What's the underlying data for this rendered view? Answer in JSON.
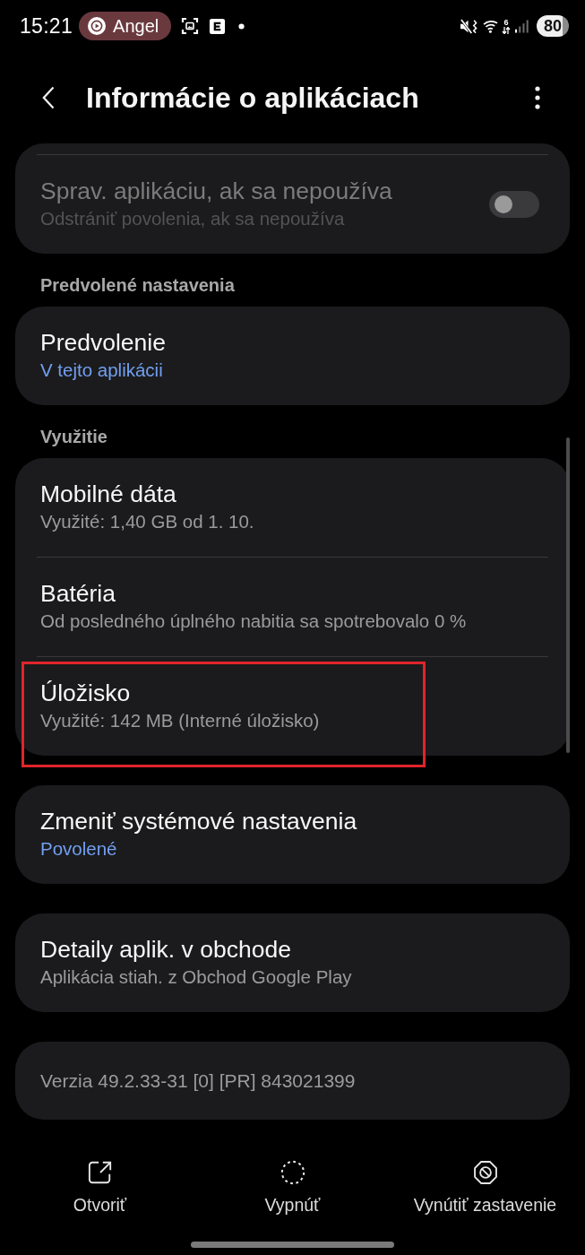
{
  "status_bar": {
    "time": "15:21",
    "chip_label": "Angel",
    "wifi_label": "6",
    "battery": "80"
  },
  "header": {
    "title": "Informácie o aplikáciach"
  },
  "sections": [
    {
      "cut_top": true,
      "items": [
        {
          "kind": "toggle",
          "title": "Sprav. aplikáciu, ak sa nepoužíva",
          "subtitle": "Odstrániť povolenia, ak sa nepoužíva",
          "on": false,
          "disabled": true,
          "highlighted": false
        }
      ]
    },
    {
      "heading": "Predvolené nastavenia",
      "cut_top": false,
      "items": [
        {
          "kind": "value",
          "title": "Predvolenie",
          "subtitle": "V tejto aplikácii",
          "disabled": false,
          "highlighted": false
        }
      ]
    },
    {
      "heading": "Využitie",
      "cut_top": false,
      "items": [
        {
          "kind": "info",
          "title": "Mobilné dáta",
          "subtitle": "Využité: 1,40 GB od 1. 10.",
          "disabled": false,
          "highlighted": false
        },
        {
          "kind": "info",
          "title": "Batéria",
          "subtitle": "Od posledného úplného nabitia sa spotrebovalo 0 %",
          "disabled": false,
          "highlighted": false
        },
        {
          "kind": "info",
          "title": "Úložisko",
          "subtitle": "Využité: 142 MB (Interné úložisko)",
          "disabled": false,
          "highlighted": true
        }
      ]
    },
    {
      "cut_top": false,
      "items": [
        {
          "kind": "value",
          "title": "Zmeniť systémové nastavenia",
          "subtitle": "Povolené",
          "disabled": false,
          "highlighted": false
        }
      ]
    },
    {
      "cut_top": false,
      "items": [
        {
          "kind": "info",
          "title": "Detaily aplik. v obchode",
          "subtitle": "Aplikácia stiah. z Obchod Google Play",
          "disabled": false,
          "highlighted": false
        }
      ]
    },
    {
      "cut_top": false,
      "items": [
        {
          "kind": "version",
          "title": "Verzia 49.2.33-31 [0] [PR] 843021399",
          "disabled": false,
          "highlighted": false
        }
      ]
    }
  ],
  "actions": [
    {
      "kind": "open",
      "label": "Otvoriť"
    },
    {
      "kind": "disable",
      "label": "Vypnúť"
    },
    {
      "kind": "force_stop",
      "label": "Vynútiť zastavenie"
    }
  ]
}
